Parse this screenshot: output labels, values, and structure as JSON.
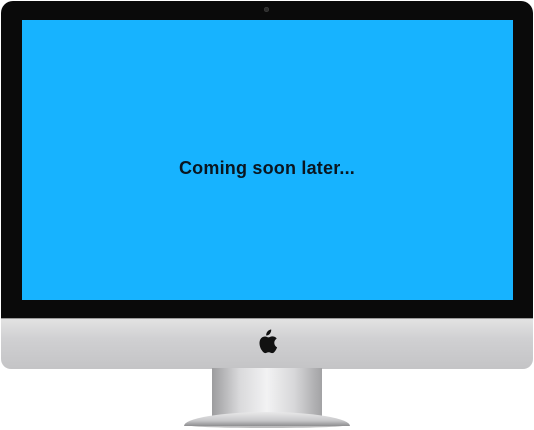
{
  "screen": {
    "message": "Coming soon later...",
    "background_color": "#17b3ff"
  },
  "device": {
    "logo_icon": "apple-logo-icon",
    "bezel_color": "#0a0a0a",
    "body_color": "#d0d0d2"
  }
}
